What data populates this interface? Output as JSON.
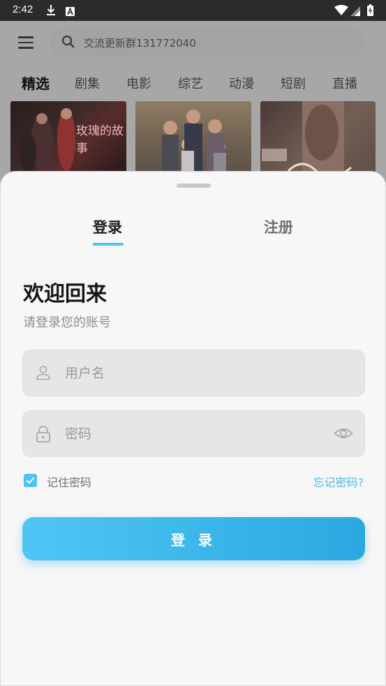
{
  "status_bar": {
    "time": "2:42",
    "icons": [
      "download-icon",
      "text-a-icon",
      "wifi-icon",
      "signal-icon",
      "battery-icon"
    ]
  },
  "background_app": {
    "search_placeholder": "交流更新群131772040",
    "categories": [
      "精选",
      "剧集",
      "电影",
      "综艺",
      "动漫",
      "短剧",
      "直播"
    ],
    "active_category": "精选",
    "posters": [
      {
        "title": "玫瑰的故事"
      },
      {
        "title": ""
      },
      {
        "title": ""
      }
    ]
  },
  "sheet": {
    "tabs": [
      {
        "label": "登录",
        "active": true
      },
      {
        "label": "注册",
        "active": false
      }
    ],
    "welcome": "欢迎回来",
    "subtitle": "请登录您的账号",
    "username": {
      "value": "",
      "placeholder": "用户名"
    },
    "password": {
      "value": "",
      "placeholder": "密码"
    },
    "remember_label": "记住密码",
    "remember_checked": true,
    "forgot_label": "忘记密码?",
    "login_button": "登 录"
  },
  "colors": {
    "accent": "#4fc3f1",
    "button_start": "#4fc6f5",
    "button_end": "#2ba8e0",
    "link": "#4fb8e6"
  }
}
